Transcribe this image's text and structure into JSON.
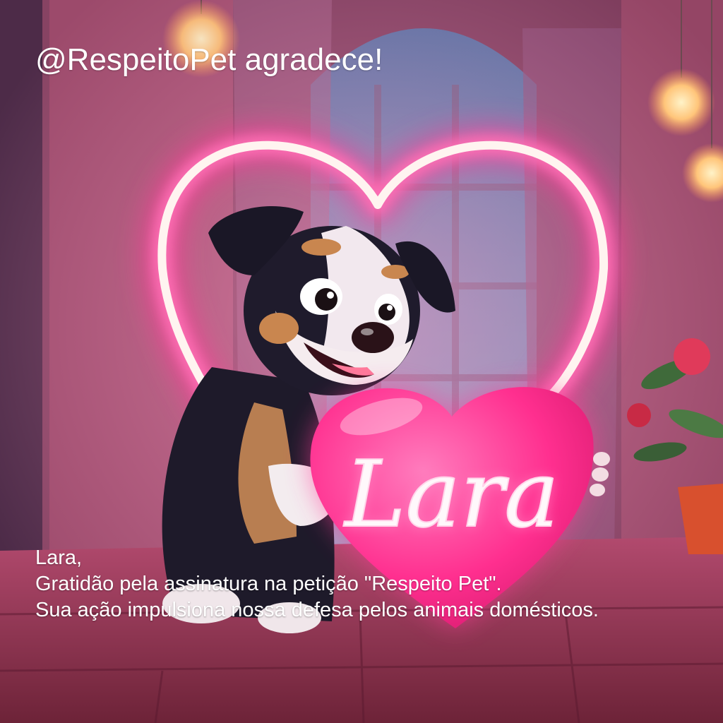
{
  "header": {
    "title": "@RespeitoPet agradece!"
  },
  "heart_sign": {
    "name": "Lara"
  },
  "caption": {
    "greeting": "Lara,",
    "line1": "Gratidão pela assinatura na petição \"Respeito Pet\".",
    "line2": "Sua ação impulsiona nossa defesa pelos animais domésticos."
  },
  "colors": {
    "neon_pink": "#ff3d9a",
    "heart_fill": "#ff2f8f",
    "text": "#ffffff"
  }
}
